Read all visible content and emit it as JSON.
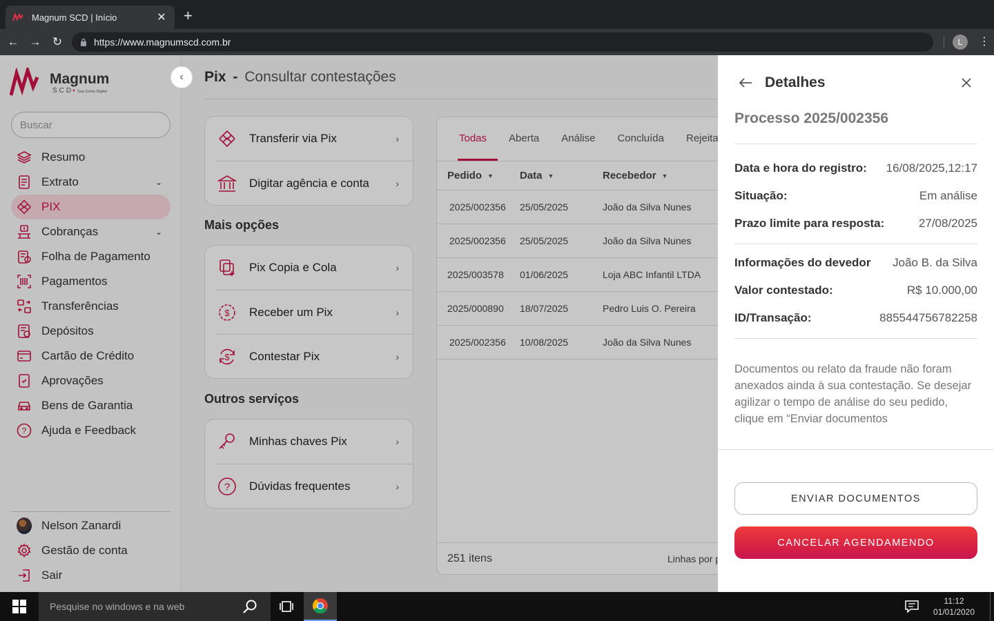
{
  "browser": {
    "tab_title": "Magnum SCD  |  Início",
    "url": "https://www.magnumscd.com.br",
    "profile_initial": "L"
  },
  "sidebar": {
    "logo_text": "Magnum",
    "logo_sub": "SCD",
    "logo_tagline": "Sua Conta Digital",
    "search_placeholder": "Buscar",
    "items": [
      {
        "label": "Resumo",
        "icon": "layers-icon"
      },
      {
        "label": "Extrato",
        "icon": "statement-icon",
        "expandable": true
      },
      {
        "label": "PIX",
        "icon": "pix-icon",
        "active": true
      },
      {
        "label": "Cobranças",
        "icon": "billing-icon",
        "expandable": true
      },
      {
        "label": "Folha de Pagamento",
        "icon": "payroll-icon"
      },
      {
        "label": "Pagamentos",
        "icon": "barcode-icon"
      },
      {
        "label": "Transferências",
        "icon": "transfer-icon"
      },
      {
        "label": "Depósitos",
        "icon": "deposit-icon"
      },
      {
        "label": "Cartão de Crédito",
        "icon": "credit-card-icon"
      },
      {
        "label": "Aprovações",
        "icon": "approval-icon"
      },
      {
        "label": "Bens de Garantia",
        "icon": "car-icon"
      },
      {
        "label": "Ajuda e Feedback",
        "icon": "help-icon"
      }
    ],
    "user_items": [
      {
        "label": "Nelson Zanardi"
      },
      {
        "label": "Gestão de conta"
      },
      {
        "label": "Sair"
      }
    ]
  },
  "main": {
    "title_section": "Pix",
    "title_sep": "-",
    "title_page": "Consultar contestações",
    "card1": [
      "Transferir via Pix",
      "Digitar agência e conta"
    ],
    "more_title": "Mais opções",
    "card2": [
      "Pix Copia e Cola",
      "Receber um Pix",
      "Contestar Pix"
    ],
    "other_title": "Outros serviços",
    "card3": [
      "Minhas chaves Pix",
      "Dúvidas frequentes"
    ],
    "tabs": [
      "Todas",
      "Aberta",
      "Análise",
      "Concluída",
      "Rejeita"
    ],
    "columns": [
      "Pedido",
      "Data",
      "Recebedor"
    ],
    "rows": [
      [
        "2025/002356",
        "25/05/2025",
        "João da Silva Nunes"
      ],
      [
        "2025/002356",
        "25/05/2025",
        "João da Silva Nunes"
      ],
      [
        "2025/003578",
        "01/06/2025",
        "Loja ABC Infantil LTDA"
      ],
      [
        "2025/000890",
        "18/07/2025",
        "Pedro Luis O. Pereira"
      ],
      [
        "2025/002356",
        "10/08/2025",
        "João da Silva Nunes"
      ]
    ],
    "item_count": "251 itens",
    "lines_per_page": "Linhas por p"
  },
  "drawer": {
    "title": "Detalhes",
    "process": "Processo 2025/002356",
    "fields1": [
      {
        "k": "Data e hora do registro:",
        "v": "16/08/2025,12:17"
      },
      {
        "k": "Situação:",
        "v": "Em análise"
      },
      {
        "k": "Prazo limite para resposta:",
        "v": "27/08/2025"
      }
    ],
    "fields2": [
      {
        "k": "Informações do devedor",
        "v": "João B. da Silva"
      },
      {
        "k": "Valor contestado:",
        "v": "R$ 10.000,00"
      },
      {
        "k": "ID/Transação:",
        "v": "885544756782258"
      }
    ],
    "message": "Documentos ou relato da fraude não foram anexados ainda à sua contestação. Se desejar agilizar o tempo de análise do seu pedido, clique em “Enviar documentos",
    "btn_send": "ENVIAR DOCUMENTOS",
    "btn_cancel": "CANCELAR AGENDAMENDO"
  },
  "taskbar": {
    "search_placeholder": "Pesquise no windows e na web",
    "time": "11:12",
    "date": "01/01/2020"
  },
  "colors": {
    "brand": "#d0144c",
    "active_bg": "#fbd9e1",
    "cancel_gradient_top": "#ee3b3b"
  }
}
